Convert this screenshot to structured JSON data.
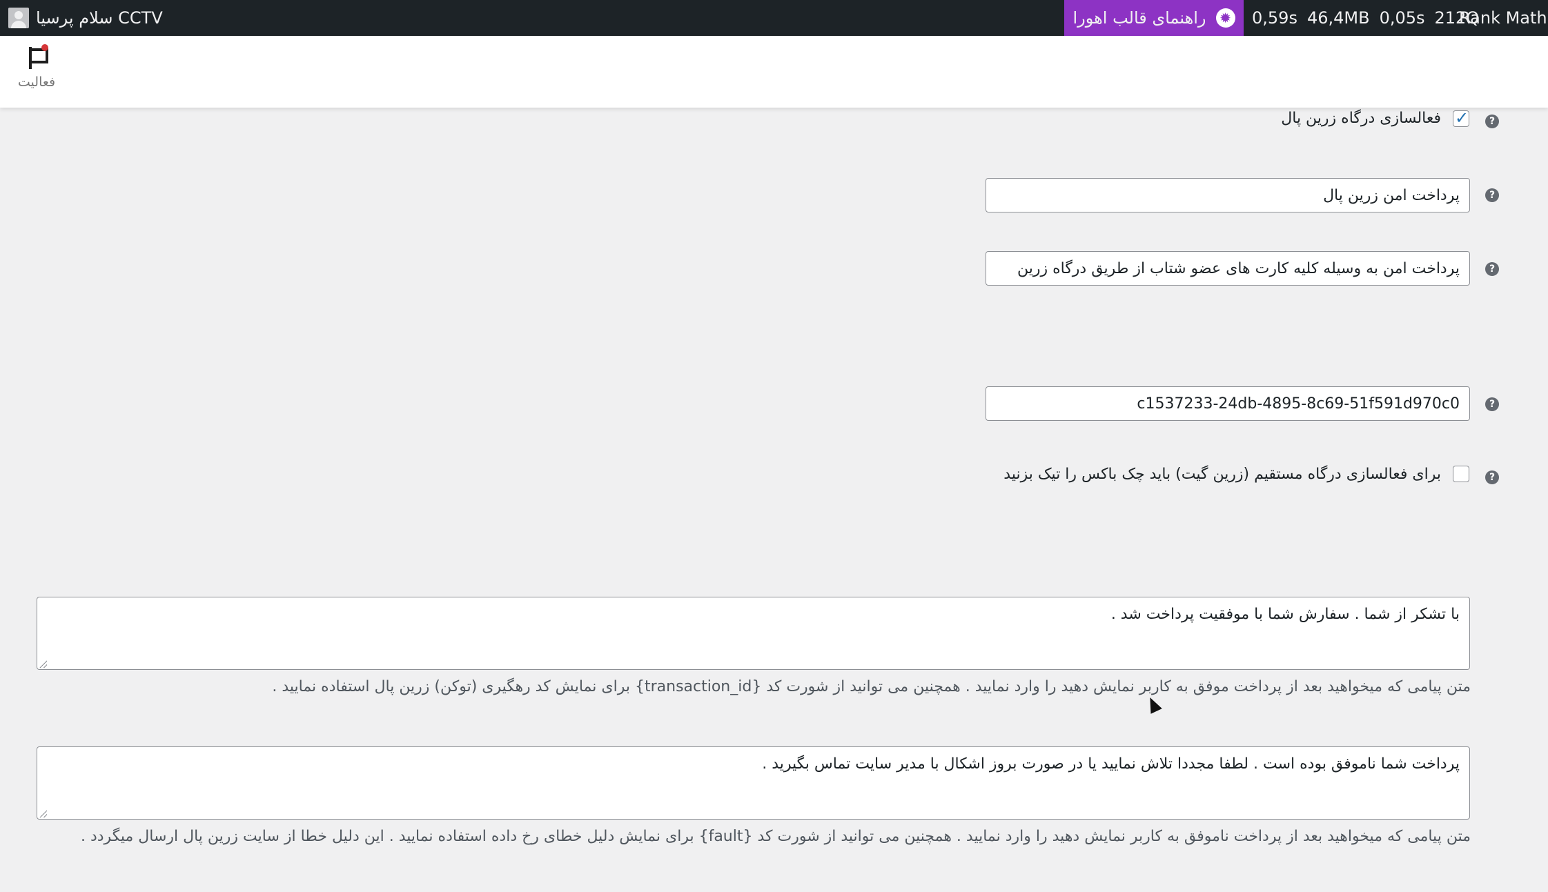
{
  "adminbar": {
    "greeting": "سلام پرسیا CCTV",
    "guide_label": "راهنمای قالب اهورا",
    "stats": {
      "time1": "0,59s",
      "memory": "46,4MB",
      "time2": "0,05s",
      "queries": "212Q"
    },
    "rank_math": "Rank Math S",
    "guide_color": "#8d33c4"
  },
  "activity": {
    "label": "فعالیت",
    "icon": "flag-icon"
  },
  "form": {
    "enable_label": "فعالسازی درگاه زرین پال",
    "enable_checked": true,
    "title_value": "پرداخت امن زرین پال",
    "description_value": "پرداخت امن به وسیله کلیه کارت های عضو شتاب از طریق درگاه زرین",
    "merchant_value": "c1537233-24db-4895-8c69-51f591d970c0",
    "direct_label": "برای فعالسازی درگاه مستقیم (زرین گیت) باید چک باکس را تیک بزنید",
    "direct_checked": false,
    "success_message": "با تشکر از شما . سفارش شما با موفقیت پرداخت شد .",
    "success_desc": "متن پیامی که میخواهید بعد از پرداخت موفق به کاربر نمایش دهید را وارد نمایید . همچنین می توانید از شورت کد {transaction_id} برای نمایش کد رهگیری (توکن) زرین پال استفاده نمایید .",
    "failed_message": "پرداخت شما ناموفق بوده است . لطفا مجددا تلاش نمایید یا در صورت بروز اشکال با مدیر سایت تماس بگیرید .",
    "failed_desc": "متن پیامی که میخواهید بعد از پرداخت ناموفق به کاربر نمایش دهید را وارد نمایید . همچنین می توانید از شورت کد {fault} برای نمایش دلیل خطای رخ داده استفاده نمایید . این دلیل خطا از سایت زرین پال ارسال میگردد ."
  }
}
